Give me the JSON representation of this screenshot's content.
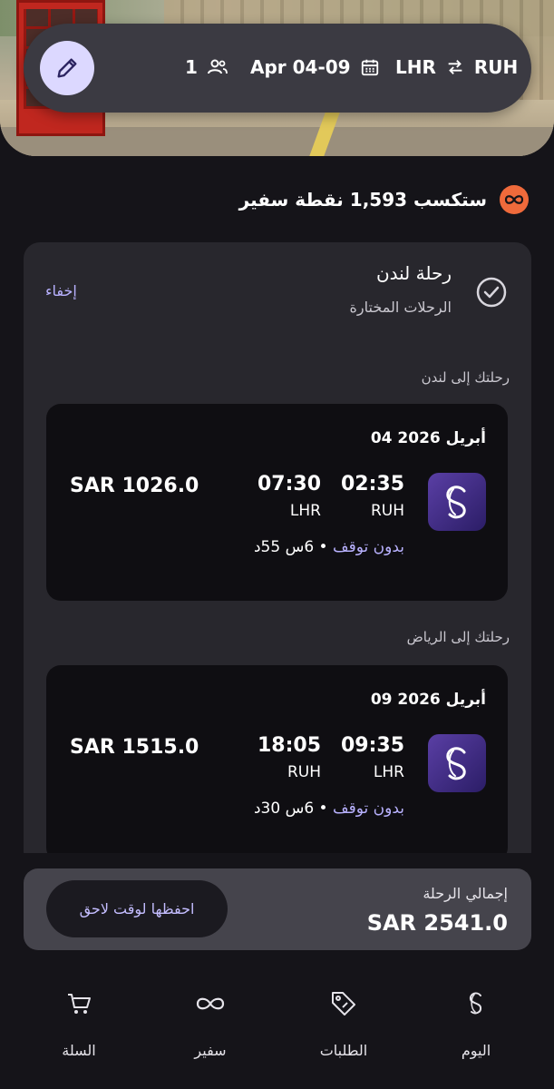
{
  "search": {
    "passengers": "1",
    "dates": "Apr 04-09",
    "origin": "LHR",
    "destination": "RUH"
  },
  "points": {
    "text": "ستكسب 1,593 نقطة سفير"
  },
  "trip": {
    "title": "رحلة لندن",
    "subtitle": "الرحلات المختارة",
    "hide_label": "إخفاء",
    "outbound_label": "رحلتك إلى لندن",
    "return_label": "رحلتك إلى الرياض"
  },
  "flights": [
    {
      "date": "04 أبريل 2026",
      "dep_time": "02:35",
      "arr_time": "07:30",
      "dep_code": "RUH",
      "arr_code": "LHR",
      "price": "SAR 1026.0",
      "stops": "بدون توقف",
      "duration": "• 6س 55د"
    },
    {
      "date": "09 أبريل 2026",
      "dep_time": "09:35",
      "arr_time": "18:05",
      "dep_code": "LHR",
      "arr_code": "RUH",
      "price": "SAR 1515.0",
      "stops": "بدون توقف",
      "duration": "• 6س 30د"
    }
  ],
  "total": {
    "label": "إجمالي الرحلة",
    "value": "SAR 2541.0",
    "save_button": "احفظها لوقت لاحق"
  },
  "nav": {
    "today": "اليوم",
    "orders": "الطلبات",
    "safeer": "سفير",
    "cart": "السلة"
  },
  "colors": {
    "accent": "#b9b2ff",
    "safeer_orange": "#ef6a3b",
    "background": "#151419"
  }
}
